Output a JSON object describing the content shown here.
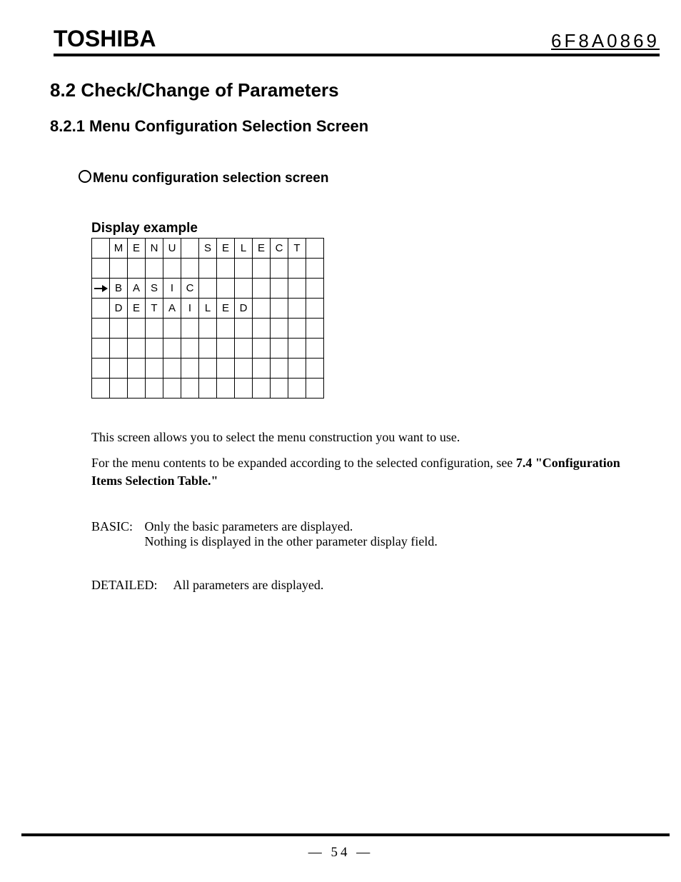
{
  "header": {
    "brand": "TOSHIBA",
    "docnum": "6F8A0869"
  },
  "section": {
    "title": "8.2 Check/Change of Parameters",
    "sub1": "8.2.1 Menu Configuration Selection Screen",
    "bullet": "Menu configuration selection screen",
    "display_label": "Display example"
  },
  "lcd": {
    "rows": [
      [
        "",
        "M",
        "E",
        "N",
        "U",
        "",
        "S",
        "E",
        "L",
        "E",
        "C",
        "T",
        ""
      ],
      [
        "",
        "",
        "",
        "",
        "",
        "",
        "",
        "",
        "",
        "",
        "",
        "",
        ""
      ],
      [
        "→",
        "B",
        "A",
        "S",
        "I",
        "C",
        "",
        "",
        "",
        "",
        "",
        "",
        ""
      ],
      [
        "",
        "D",
        "E",
        "T",
        "A",
        "I",
        "L",
        "E",
        "D",
        "",
        "",
        "",
        ""
      ],
      [
        "",
        "",
        "",
        "",
        "",
        "",
        "",
        "",
        "",
        "",
        "",
        "",
        ""
      ],
      [
        "",
        "",
        "",
        "",
        "",
        "",
        "",
        "",
        "",
        "",
        "",
        "",
        ""
      ],
      [
        "",
        "",
        "",
        "",
        "",
        "",
        "",
        "",
        "",
        "",
        "",
        "",
        ""
      ],
      [
        "",
        "",
        "",
        "",
        "",
        "",
        "",
        "",
        "",
        "",
        "",
        "",
        ""
      ]
    ]
  },
  "body": {
    "p1": "This screen allows you to select the menu construction you want to use.",
    "p2a": "For the menu contents to be expanded according to the selected configuration, see ",
    "p2b": "7.4 \"Configuration Items Selection Table.\"",
    "basic_label": "BASIC:",
    "basic_l1": "Only the basic parameters are displayed.",
    "basic_l2": "Nothing is displayed in the other parameter display field.",
    "detailed_label": "DETAILED:",
    "detailed_l1": "All parameters are displayed."
  },
  "footer": {
    "page": "—   54   —"
  }
}
